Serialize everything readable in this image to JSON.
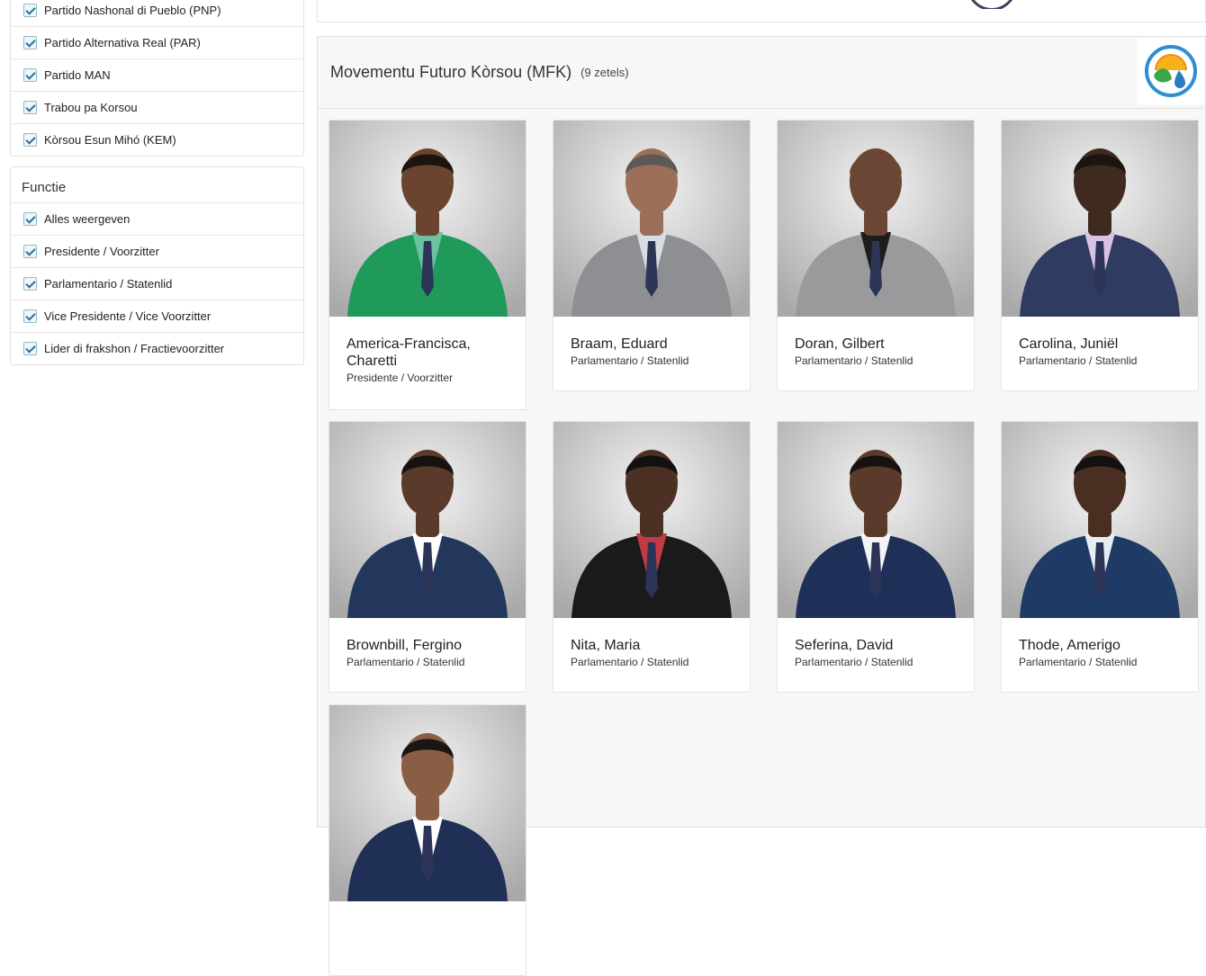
{
  "filters": {
    "parties": [
      {
        "label": "Partido Nashonal di Pueblo (PNP)",
        "checked": true
      },
      {
        "label": "Partido Alternativa Real (PAR)",
        "checked": true
      },
      {
        "label": "Partido MAN",
        "checked": true
      },
      {
        "label": "Trabou pa Korsou",
        "checked": true
      },
      {
        "label": "Kòrsou Esun Mihó (KEM)",
        "checked": true
      }
    ],
    "functie": {
      "title": "Functie",
      "items": [
        {
          "label": "Alles weergeven",
          "checked": true
        },
        {
          "label": "Presidente / Voorzitter",
          "checked": true
        },
        {
          "label": "Parlamentario / Statenlid",
          "checked": true
        },
        {
          "label": "Vice Presidente / Vice Voorzitter",
          "checked": true
        },
        {
          "label": "Lider di frakshon / Fractievoorzitter",
          "checked": true
        }
      ]
    }
  },
  "party": {
    "name": "Movementu Futuro Kòrsou (MFK)",
    "seats": "(9 zetels)",
    "logo_icon": "mfk-logo-icon",
    "members": [
      {
        "name": "America-Francisca, Charetti",
        "role": "Presidente / Voorzitter",
        "suit": "#1f9a5a",
        "shirt": "#6cc1a0",
        "skin": "#6b4430",
        "hair": "#1b1410"
      },
      {
        "name": "Braam, Eduard",
        "role": "Parlamentario / Statenlid",
        "suit": "#8e8f92",
        "shirt": "#d7dde3",
        "skin": "#9c7058",
        "hair": "#5c5a58"
      },
      {
        "name": "Doran, Gilbert",
        "role": "Parlamentario / Statenlid",
        "suit": "#9a9a9c",
        "shirt": "#1d1d1d",
        "skin": "#6c4634",
        "hair": "#6c4634"
      },
      {
        "name": "Carolina, Juniël",
        "role": "Parlamentario / Statenlid",
        "suit": "#2f3b60",
        "shirt": "#d9c3e4",
        "skin": "#3f2a20",
        "hair": "#1a1412"
      },
      {
        "name": "Brownbill, Fergino",
        "role": "Parlamentario / Statenlid",
        "suit": "#23375d",
        "shirt": "#ffffff",
        "skin": "#5a3a2a",
        "hair": "#171210"
      },
      {
        "name": "Nita, Maria",
        "role": "Parlamentario / Statenlid",
        "suit": "#1a1a1a",
        "shirt": "#c23b44",
        "skin": "#4d3024",
        "hair": "#111111"
      },
      {
        "name": "Seferina, David",
        "role": "Parlamentario / Statenlid",
        "suit": "#1e2f58",
        "shirt": "#f2f4f7",
        "skin": "#5a3a2a",
        "hair": "#171210"
      },
      {
        "name": "Thode, Amerigo",
        "role": "Parlamentario / Statenlid",
        "suit": "#1f3a64",
        "shirt": "#e6edf5",
        "skin": "#4a2e22",
        "hair": "#121010"
      },
      {
        "name": "",
        "role": "",
        "suit": "#1f2f55",
        "shirt": "#ffffff",
        "skin": "#8a5e45",
        "hair": "#1b1614"
      }
    ]
  }
}
